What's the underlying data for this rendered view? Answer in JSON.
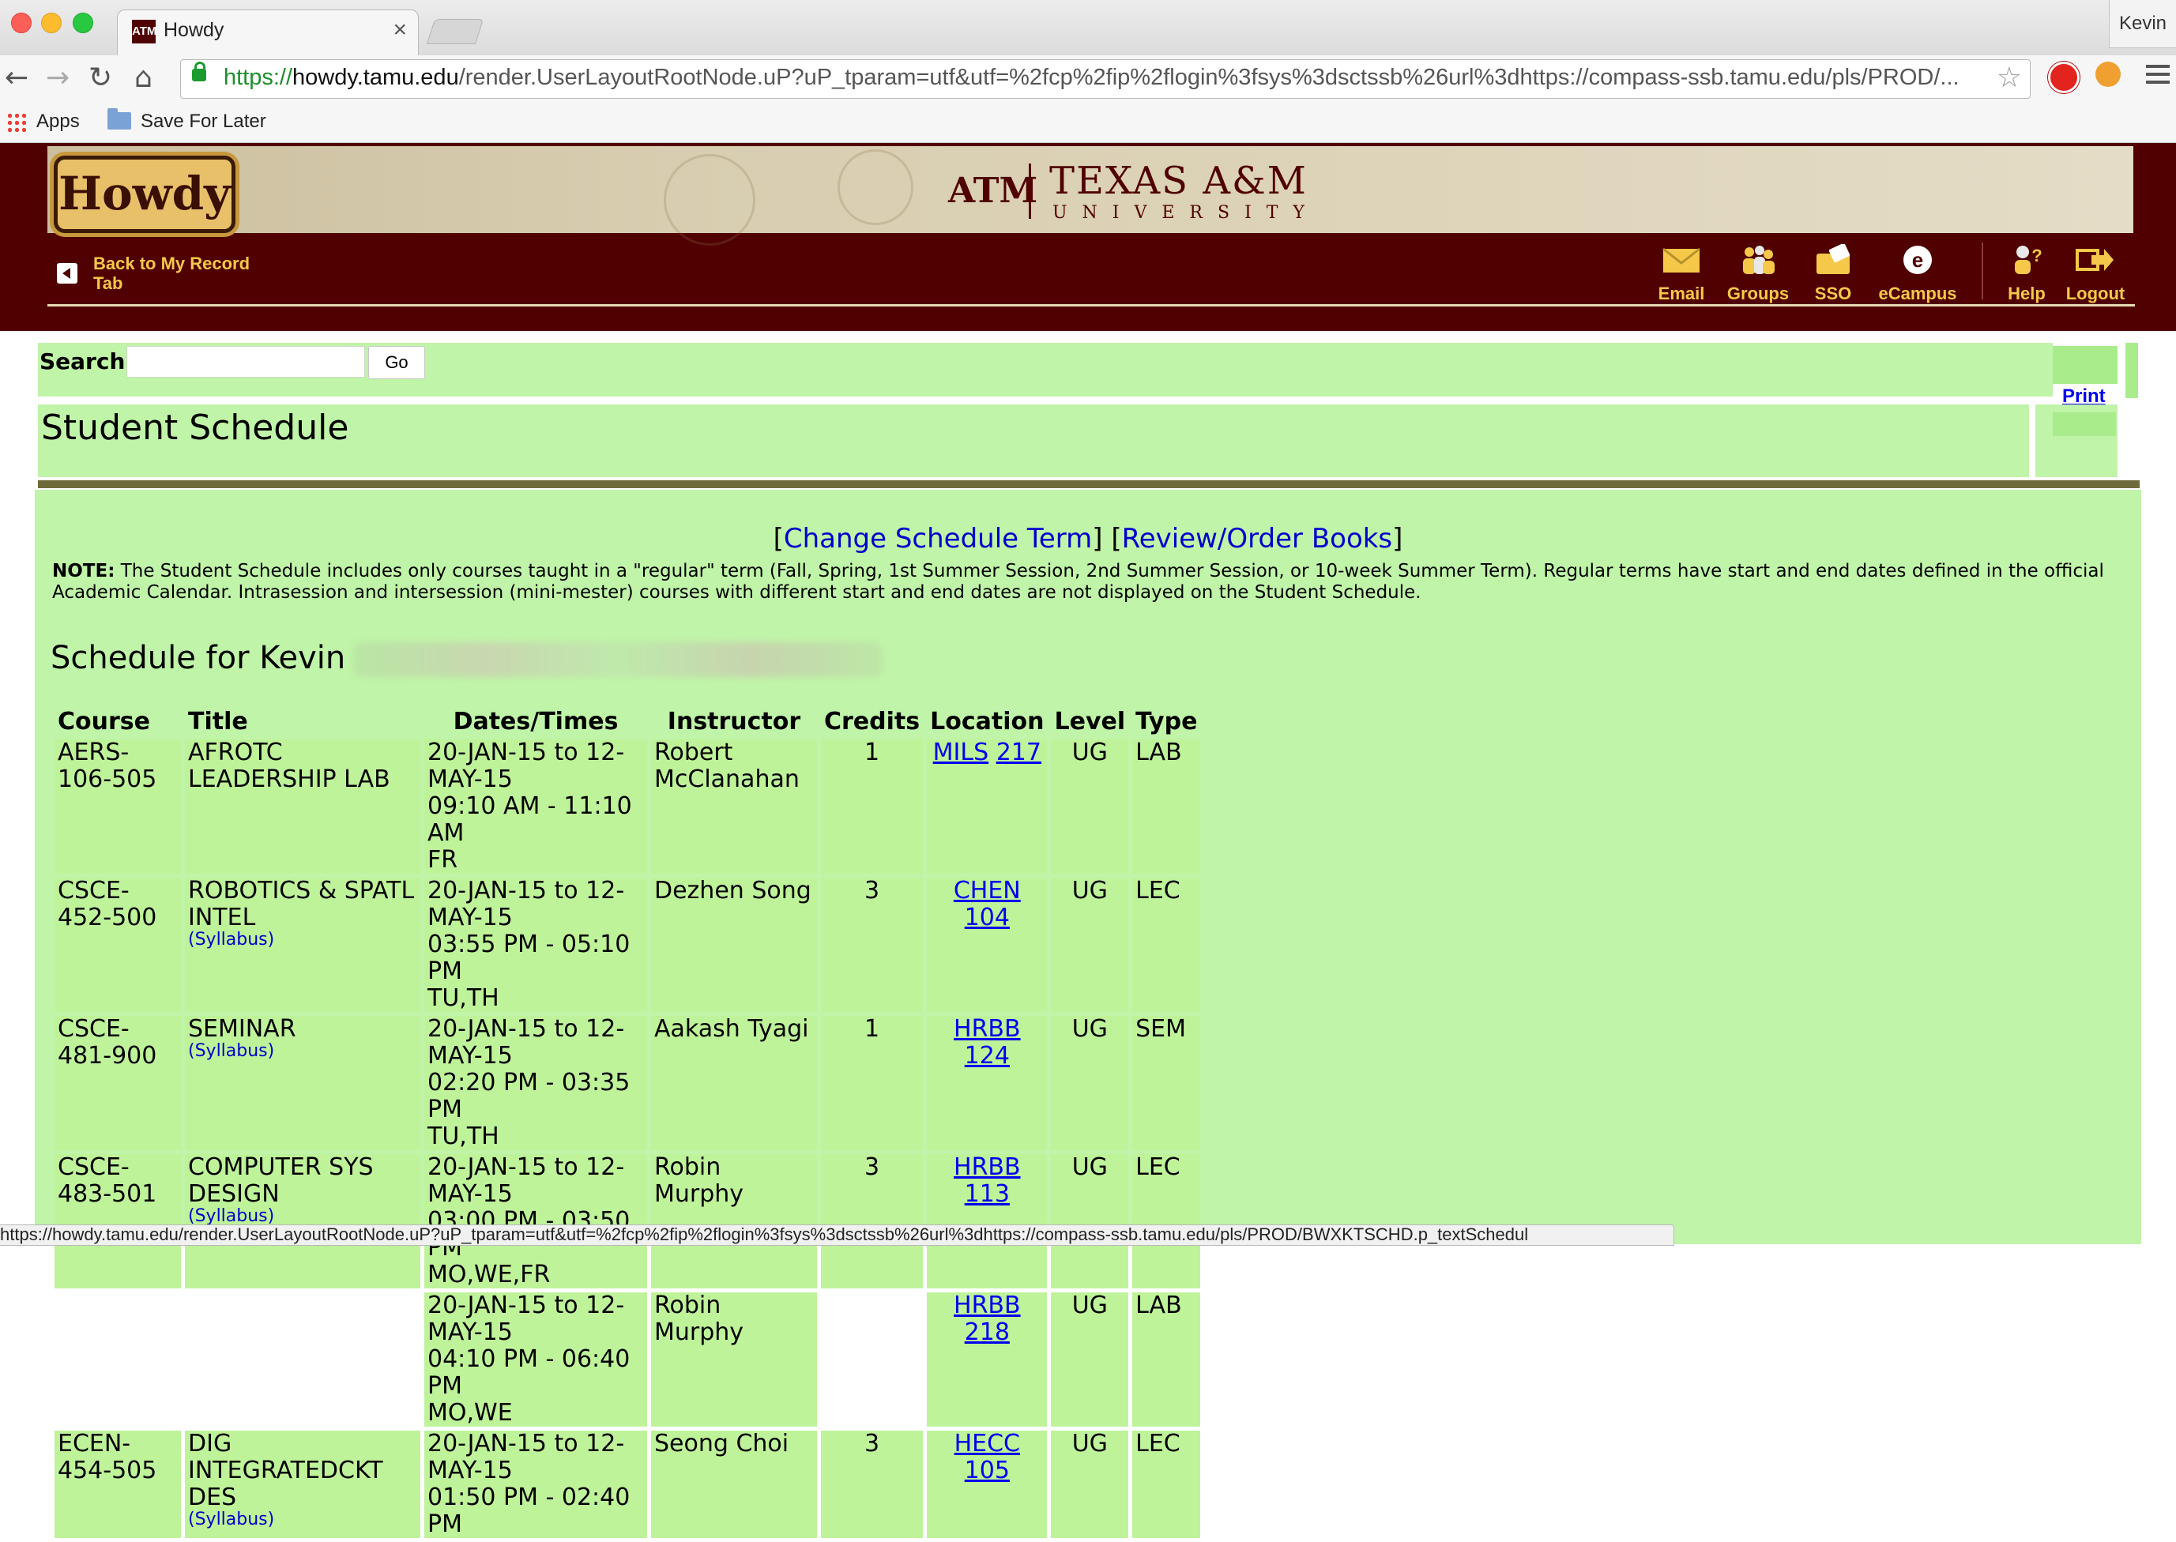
{
  "browser": {
    "tab_title": "Howdy",
    "tab_favicon": "ATM",
    "tab_close": "×",
    "profile_name": "Kevin",
    "url_scheme": "https://",
    "url_host": "howdy.tamu.edu",
    "url_path": "/render.UserLayoutRootNode.uP?uP_tparam=utf&utf=%2fcp%2fip%2flogin%3fsys%3dsctssb%26url%3dhttps://compass-ssb.tamu.edu/pls/PROD/...",
    "bookmarks": [
      {
        "label": "Apps"
      },
      {
        "label": "Save For Later"
      }
    ],
    "status_url": "https://howdy.tamu.edu/render.UserLayoutRootNode.uP?uP_tparam=utf&utf=%2fcp%2fip%2flogin%3fsys%3dsctssb%26url%3dhttps://compass-ssb.tamu.edu/pls/PROD/BWXKTSCHD.p_textSchedul"
  },
  "header": {
    "logo_text": "Howdy",
    "university_mark": "ATM",
    "university_name": "TEXAS A&M",
    "university_sub": "UNIVERSITY",
    "back_link": "Back to My Record Tab",
    "nav": [
      {
        "label": "Email",
        "icon": "envelope-icon"
      },
      {
        "label": "Groups",
        "icon": "groups-icon"
      },
      {
        "label": "SSO",
        "icon": "sso-icon"
      },
      {
        "label": "eCampus",
        "icon": "ecampus-icon"
      },
      {
        "label": "Help",
        "icon": "help-icon"
      },
      {
        "label": "Logout",
        "icon": "logout-icon"
      }
    ],
    "colors": {
      "maroon": "#500000",
      "gold": "#f5c84a",
      "banner": "#d8cdb0"
    }
  },
  "search": {
    "label": "Search",
    "value": "",
    "button": "Go"
  },
  "print_label": "Print",
  "page_title": "Student Schedule",
  "term_links": {
    "open1": "[",
    "change_term": "Change Schedule Term",
    "between": "] [",
    "review_books": "Review/Order Books",
    "close2": "]"
  },
  "note": {
    "label": "NOTE:",
    "text": " The Student Schedule includes only courses taught in a \"regular\" term (Fall, Spring, 1st Summer Session, 2nd Summer Session, or 10-week Summer Term). Regular terms have start and end dates defined in the official Academic Calendar. Intrasession and intersession (mini-mester) courses with different start and end dates are not displayed on the Student Schedule."
  },
  "schedule_heading": "Schedule for Kevin",
  "table": {
    "headers": [
      "Course",
      "Title",
      "Dates/Times",
      "Instructor",
      "Credits",
      "Location",
      "Level",
      "Type"
    ],
    "syllabus_label": "(Syllabus)",
    "rows": [
      {
        "course": "AERS-106-505",
        "title": "AFROTC LEADERSHIP LAB",
        "syllabus": false,
        "dates": "20-JAN-15 to 12-MAY-15",
        "times": "09:10 AM - 11:10 AM",
        "days": "FR",
        "instructor": "Robert McClanahan",
        "credits": "1",
        "building": "MILS",
        "room": "217",
        "level": "UG",
        "type": "LAB",
        "continuation": false
      },
      {
        "course": "CSCE-452-500",
        "title": "ROBOTICS & SPATL INTEL",
        "syllabus": true,
        "dates": "20-JAN-15 to 12-MAY-15",
        "times": "03:55 PM - 05:10 PM",
        "days": "TU,TH",
        "instructor": "Dezhen Song",
        "credits": "3",
        "building": "CHEN",
        "room": "104",
        "level": "UG",
        "type": "LEC",
        "continuation": false
      },
      {
        "course": "CSCE-481-900",
        "title": "SEMINAR",
        "syllabus": true,
        "dates": "20-JAN-15 to 12-MAY-15",
        "times": "02:20 PM - 03:35 PM",
        "days": "TU,TH",
        "instructor": "Aakash Tyagi",
        "credits": "1",
        "building": "HRBB",
        "room": "124",
        "level": "UG",
        "type": "SEM",
        "continuation": false
      },
      {
        "course": "CSCE-483-501",
        "title": "COMPUTER SYS DESIGN",
        "syllabus": true,
        "dates": "20-JAN-15 to 12-MAY-15",
        "times": "03:00 PM - 03:50 PM",
        "days": "MO,WE,FR",
        "instructor": "Robin Murphy",
        "credits": "3",
        "building": "HRBB",
        "room": "113",
        "level": "UG",
        "type": "LEC",
        "continuation": false
      },
      {
        "course": "",
        "title": "",
        "syllabus": false,
        "dates": "20-JAN-15 to 12-MAY-15",
        "times": "04:10 PM - 06:40 PM",
        "days": "MO,WE",
        "instructor": "Robin Murphy",
        "credits": "",
        "building": "HRBB",
        "room": "218",
        "level": "UG",
        "type": "LAB",
        "continuation": true
      },
      {
        "course": "ECEN-454-505",
        "title": "DIG INTEGRATEDCKT DES",
        "syllabus": true,
        "dates": "20-JAN-15 to 12-MAY-15",
        "times": "01:50 PM - 02:40 PM",
        "days": "",
        "instructor": "Seong Choi",
        "credits": "3",
        "building": "HECC",
        "room": "105",
        "level": "UG",
        "type": "LEC",
        "continuation": false
      }
    ]
  },
  "colors": {
    "page_green": "#c0f4a8",
    "cell_green": "#bff39a",
    "link_blue": "#0000ee",
    "rule_olive": "#6f6a3a"
  }
}
